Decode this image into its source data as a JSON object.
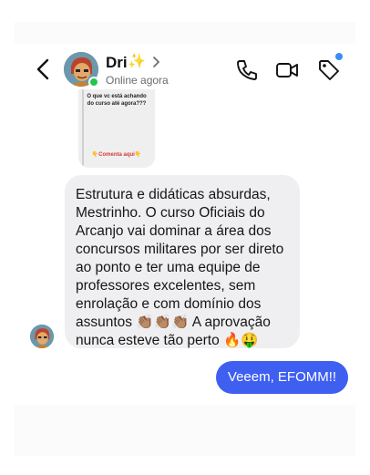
{
  "header": {
    "contact_name": "Dri",
    "name_emoji": "✨",
    "status": "Online agora"
  },
  "icons": {
    "back": "chevron-left-icon",
    "profile": "chevron-right-icon",
    "call": "phone-icon",
    "video": "video-camera-icon",
    "tag": "tag-icon"
  },
  "colors": {
    "online": "#23c552",
    "outgoing_bubble": "#3e5ff0",
    "incoming_bubble": "#efeff1",
    "notification_dot": "#3b8cf3"
  },
  "story_reply": {
    "question": "O que vc está achando do curso até agora???",
    "cta": "👇Comenta aqui👇"
  },
  "messages": [
    {
      "direction": "incoming",
      "text": "Estrutura e didáticas absurdas, Mestrinho. O curso Oficiais do Arcanjo vai dominar a área dos concursos militares por ser direto ao ponto e ter uma equipe de professores excelentes, sem enrolação e com domínio dos assuntos 👏🏽👏🏽👏🏽 A aprovação nunca esteve tão perto 🔥🤑"
    },
    {
      "direction": "outgoing",
      "text": "Veeem, EFOMM!!"
    }
  ]
}
